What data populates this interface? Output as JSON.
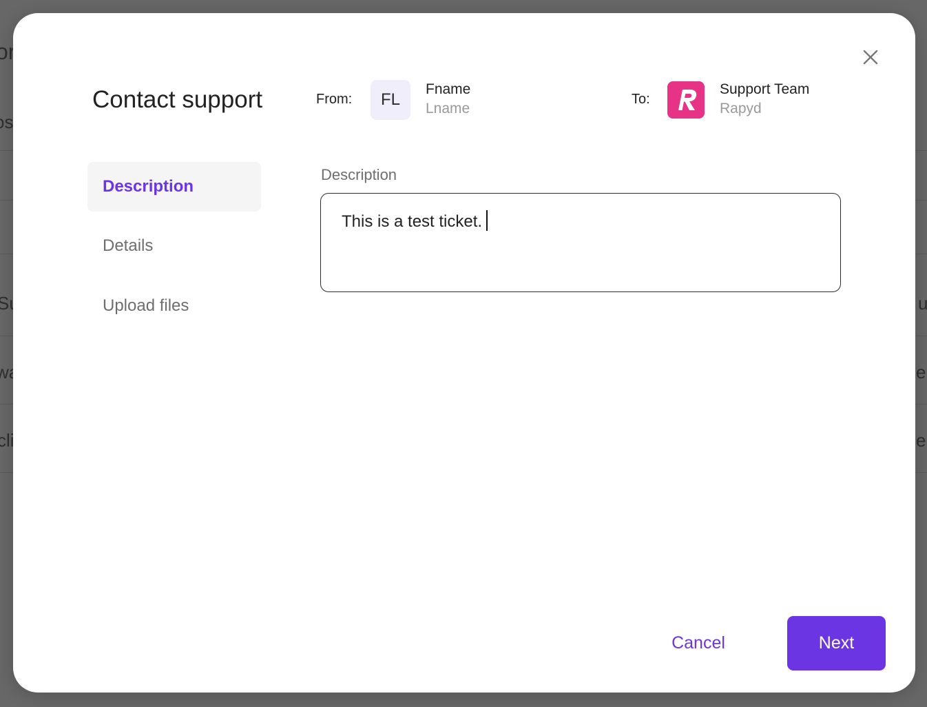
{
  "dialog": {
    "title": "Contact support",
    "close_icon": "close-icon"
  },
  "from": {
    "label": "From:",
    "avatar_initials": "FL",
    "first_name": "Fname",
    "last_name": "Lname"
  },
  "to": {
    "label": "To:",
    "logo_icon": "rapyd-logo",
    "team": "Support Team",
    "company": "Rapyd"
  },
  "steps": [
    {
      "label": "Description",
      "active": true
    },
    {
      "label": "Details",
      "active": false
    },
    {
      "label": "Upload files",
      "active": false
    }
  ],
  "description": {
    "label": "Description",
    "value": "This is a test ticket."
  },
  "footer": {
    "cancel_label": "Cancel",
    "next_label": "Next"
  },
  "colors": {
    "accent": "#6c35e4",
    "brand": "#e63386",
    "overlay": "#676767"
  },
  "background_fragments": [
    "or",
    "os",
    "Su",
    "wa",
    "cli",
    "u",
    "eb",
    "eb"
  ]
}
